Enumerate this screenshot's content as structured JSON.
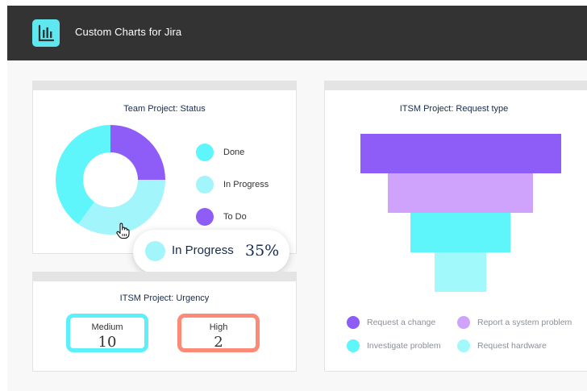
{
  "app": {
    "title": "Custom Charts for Jira"
  },
  "colors": {
    "header": "#333333",
    "logo": "#5ee7ef",
    "done": "#5ef5fb",
    "in_progress": "#a2f5fb",
    "to_do": "#8e5cf6",
    "medium_border": "#5ef0fa",
    "high_border": "#fc8a76"
  },
  "status_chart": {
    "title": "Team Project: Status",
    "legend": [
      {
        "label": "Done",
        "color": "#5ef5fb"
      },
      {
        "label": "In Progress",
        "color": "#a2f5fb"
      },
      {
        "label": "To Do",
        "color": "#8e5cf6"
      }
    ],
    "tooltip": {
      "label": "In Progress",
      "value": "35%"
    }
  },
  "urgency": {
    "title": "ITSM Project: Urgency",
    "items": [
      {
        "label": "Medium",
        "value": "10"
      },
      {
        "label": "High",
        "value": "2"
      }
    ]
  },
  "request_chart": {
    "title": "ITSM Project: Request type",
    "legend": [
      {
        "label": "Request a change",
        "color": "#8e5cf6"
      },
      {
        "label": "Report a system problem",
        "color": "#cfa3fb"
      },
      {
        "label": "Investigate problem",
        "color": "#5ef5fb"
      },
      {
        "label": "Request hardware",
        "color": "#a2f9fc"
      }
    ]
  },
  "chart_data": [
    {
      "type": "pie",
      "title": "Team Project: Status",
      "categories": [
        "To Do",
        "In Progress",
        "Done"
      ],
      "values": [
        25,
        35,
        40
      ],
      "colors": [
        "#8e5cf6",
        "#a2f5fb",
        "#5ef5fb"
      ]
    },
    {
      "type": "bar",
      "title": "ITSM Project: Request type",
      "categories": [
        "Request a change",
        "Report a system problem",
        "Investigate problem",
        "Request hardware"
      ],
      "values": [
        100,
        72,
        50,
        26
      ],
      "colors": [
        "#8e5cf6",
        "#cfa3fb",
        "#5ef5fb",
        "#a2f9fc"
      ]
    }
  ]
}
